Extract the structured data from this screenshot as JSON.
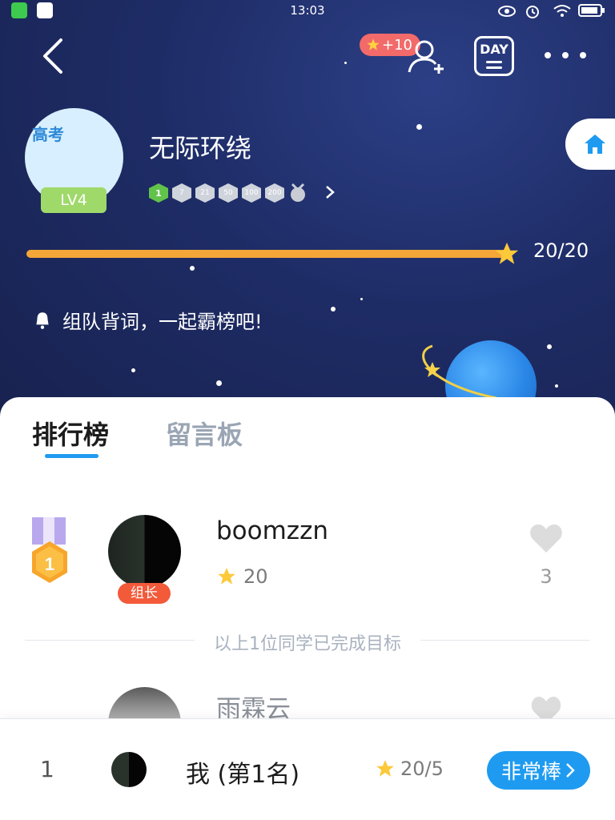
{
  "status_bar": {
    "time": "13:03"
  },
  "header": {
    "bonus_badge": "+10",
    "day_button": "DAY"
  },
  "profile": {
    "avatar_tag": "高考",
    "level": "LV4",
    "name": "无际环绕",
    "badge_levels": [
      "1",
      "7",
      "21",
      "50",
      "100",
      "200"
    ],
    "progress_text": "20/20",
    "progress_fraction": 1.0
  },
  "notice": "组队背词，一起霸榜吧!",
  "tabs": [
    {
      "label": "排行榜",
      "active": true
    },
    {
      "label": "留言板",
      "active": false
    }
  ],
  "leaderboard": {
    "rows": [
      {
        "name": "boomzzn",
        "score": "20",
        "likes": "3",
        "tag": "组长"
      },
      {
        "name": "雨霖云"
      }
    ],
    "divider_text": "以上1位同学已完成目标"
  },
  "bottom_bar": {
    "rank": "1",
    "name": "我 (第1名)",
    "score": "20/5",
    "cta": "非常棒"
  },
  "colors": {
    "accent": "#1e9bf0",
    "progress": "#f4a638",
    "leader_tag": "#f25a3a",
    "level_badge": "#9fd96a"
  }
}
